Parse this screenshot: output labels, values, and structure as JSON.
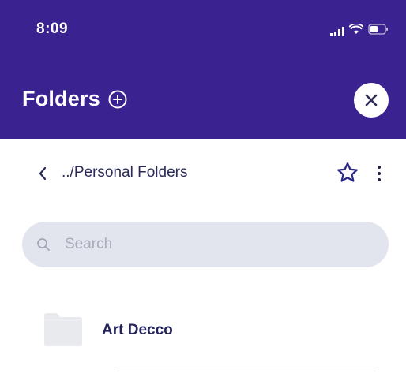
{
  "status_bar": {
    "time": "8:09",
    "icons": [
      "signal-icon",
      "wifi-icon",
      "battery-icon"
    ]
  },
  "header": {
    "title": "Folders",
    "add_icon": "plus-circle-icon",
    "close_icon": "close-icon",
    "background": "#3a2290"
  },
  "breadcrumb": {
    "back_icon": "chevron-left-icon",
    "path": "../Personal Folders",
    "star_icon": "star-outline-icon",
    "more_icon": "vertical-ellipsis-icon"
  },
  "search": {
    "placeholder": "Search",
    "value": "",
    "icon": "search-icon"
  },
  "folders": [
    {
      "name": "Art Decco",
      "icon": "folder-icon"
    }
  ]
}
